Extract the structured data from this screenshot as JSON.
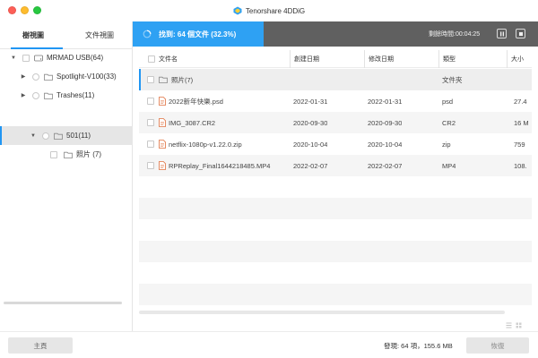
{
  "window": {
    "title": "Tenorshare 4DDiG",
    "colors": {
      "accent": "#2ea1f3",
      "status_bg": "#606060",
      "close": "#fd5f57",
      "minimize": "#febc2e",
      "zoom": "#28c840"
    }
  },
  "sidebar": {
    "tabs": [
      {
        "label": "樹視圖",
        "active": true
      },
      {
        "label": "文件視圖",
        "active": false
      }
    ],
    "tree": [
      {
        "label": "MRMAD USB(64)",
        "expanded": true,
        "selected": false
      },
      {
        "label": "Spotlight-V100(33)",
        "expanded": false,
        "selected": false
      },
      {
        "label": "Trashes(11)",
        "expanded": false,
        "selected": false
      },
      {
        "label": "501(11)",
        "expanded": true,
        "selected": true
      },
      {
        "label": "照片 (7)",
        "expanded": false,
        "selected": false
      }
    ]
  },
  "status": {
    "found_text": "找到: 64 個文件 (32.3%)",
    "progress_percent": 32.3,
    "timer_label": "剩餘時間:",
    "timer_value": "00:04:25",
    "pause_icon": "pause-icon",
    "stop_icon": "stop-icon"
  },
  "table": {
    "columns": [
      "文件名",
      "創建日期",
      "修改日期",
      "類型",
      "大小"
    ],
    "rows": [
      {
        "name": "照片(7)",
        "created": "",
        "modified": "",
        "type": "文件夾",
        "size": "",
        "icon": "folder-icon",
        "selected": true
      },
      {
        "name": "2022新年快樂.psd",
        "created": "2022-01-31",
        "modified": "2022-01-31",
        "type": "psd",
        "size": "27.4",
        "icon": "file-icon",
        "selected": false
      },
      {
        "name": "IMG_3087.CR2",
        "created": "2020-09-30",
        "modified": "2020-09-30",
        "type": "CR2",
        "size": "16 M",
        "icon": "file-icon",
        "selected": false
      },
      {
        "name": "netflix-1080p-v1.22.0.zip",
        "created": "2020-10-04",
        "modified": "2020-10-04",
        "type": "zip",
        "size": "759",
        "icon": "file-icon",
        "selected": false
      },
      {
        "name": "RPReplay_Final1644218485.MP4",
        "created": "2022-02-07",
        "modified": "2022-02-07",
        "type": "MP4",
        "size": "108.",
        "icon": "file-icon",
        "selected": false
      }
    ]
  },
  "bottom": {
    "home_label": "主頁",
    "summary": "發現: 64 項，155.6 MB",
    "recover_label": "恢復"
  }
}
